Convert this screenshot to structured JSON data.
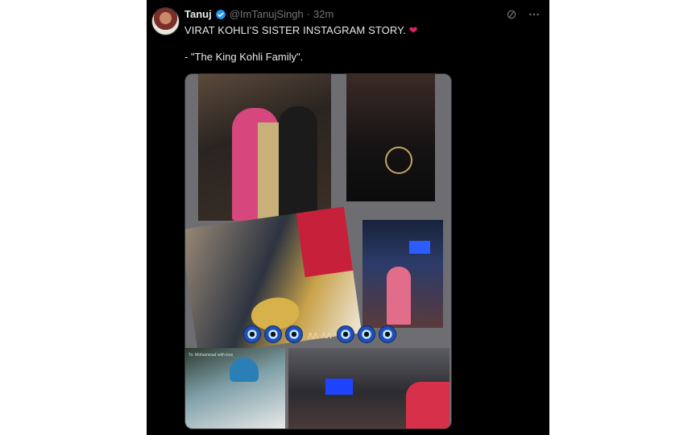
{
  "tweet": {
    "author_name": "Tanuj",
    "handle": "@ImTanujSingh",
    "separator": "·",
    "time": "32m",
    "line1": "VIRAT KOHLI'S SISTER INSTAGRAM STORY.",
    "emoji_heart": "❤",
    "line2": "- \"The King Kohli Family\"."
  },
  "icons": {
    "verified": "verified-badge-icon",
    "grok": "grok-icon",
    "more": "more-options-icon"
  },
  "colors": {
    "background": "#000000",
    "text": "#e7e9ea",
    "muted": "#71767b",
    "verified": "#1d9bf0",
    "heart": "#e0245e"
  },
  "media": {
    "caption_small": "To: Mohammad with love"
  }
}
